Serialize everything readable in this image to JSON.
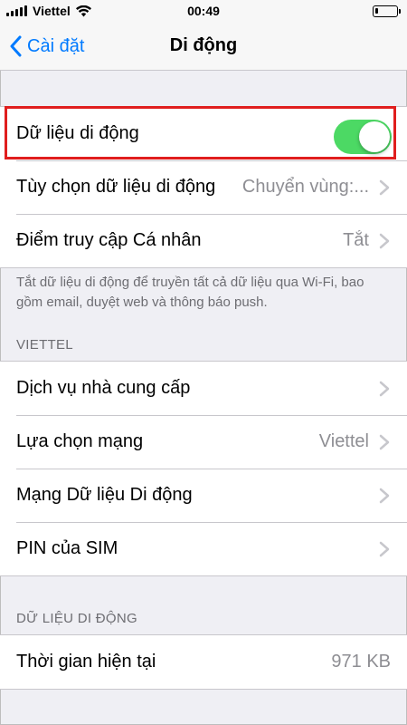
{
  "status_bar": {
    "carrier": "Viettel",
    "time": "00:49",
    "icons": [
      "signal-icon",
      "wifi-icon",
      "battery-icon"
    ],
    "battery_level": 0.15
  },
  "nav": {
    "back_label": "Cài đặt",
    "title": "Di động"
  },
  "colors": {
    "accent": "#007aff",
    "toggle_on": "#4cd964",
    "highlight": "#e01e1e",
    "background": "#efeff4"
  },
  "cellular_group": {
    "data_toggle": {
      "label": "Dữ liệu di động",
      "on": true
    },
    "options": {
      "label": "Tùy chọn dữ liệu di động",
      "value": "Chuyển vùng:..."
    },
    "hotspot": {
      "label": "Điểm truy cập Cá nhân",
      "value": "Tắt"
    }
  },
  "footnote": "Tắt dữ liệu di động để truyền tất cả dữ liệu qua Wi-Fi, bao gồm email, duyệt web và thông báo push.",
  "viettel_section": {
    "header": "VIETTEL",
    "rows": [
      {
        "label": "Dịch vụ nhà cung cấp",
        "value": ""
      },
      {
        "label": "Lựa chọn mạng",
        "value": "Viettel"
      },
      {
        "label": "Mạng Dữ liệu Di động",
        "value": ""
      },
      {
        "label": "PIN của SIM",
        "value": ""
      }
    ]
  },
  "usage_section": {
    "header": "DỮ LIỆU DI ĐỘNG",
    "current_period": {
      "label": "Thời gian hiện tại",
      "value": "971 KB"
    }
  }
}
